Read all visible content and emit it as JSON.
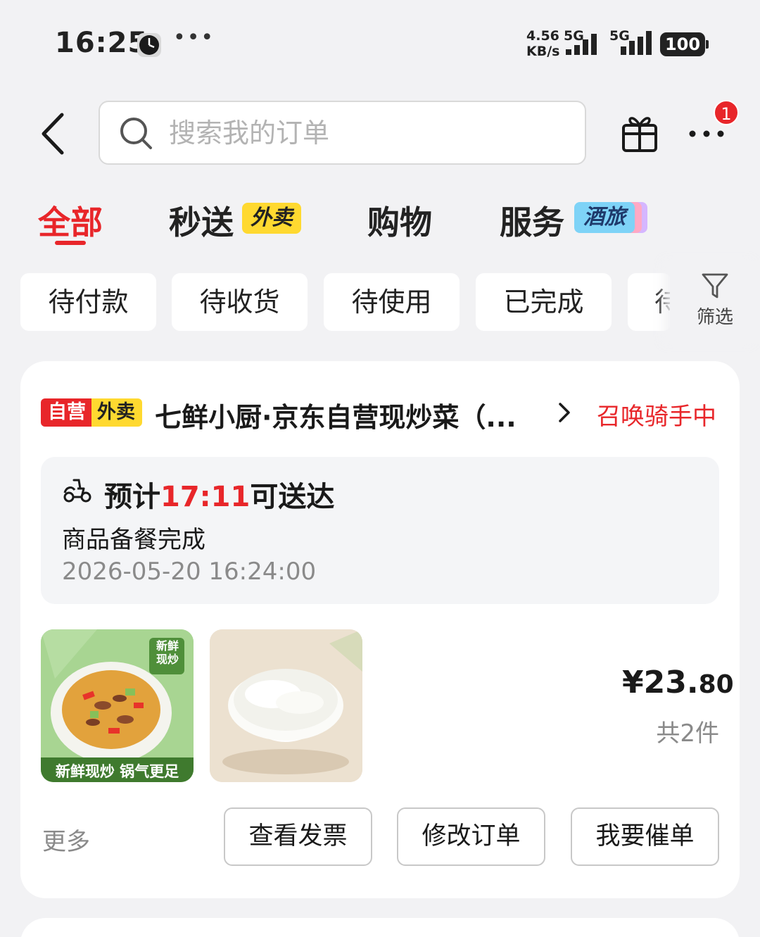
{
  "status_bar": {
    "time": "16:25",
    "net_speed_value": "4.56",
    "net_speed_unit": "KB/s",
    "network_1": "5G",
    "network_2": "5G",
    "battery": "100"
  },
  "header": {
    "search_placeholder": "搜索我的订单",
    "notification_count": "1"
  },
  "tabs": [
    {
      "label": "全部",
      "active": true
    },
    {
      "label": "秒送",
      "tag": "外卖"
    },
    {
      "label": "购物"
    },
    {
      "label": "服务",
      "tag": "酒旅"
    }
  ],
  "filter_chips": [
    "待付款",
    "待收货",
    "待使用",
    "已完成",
    "待"
  ],
  "filter_label": "筛选",
  "order": {
    "tag_self": "自营",
    "tag_type": "外卖",
    "store_name": "七鲜小厨·京东自营现炒菜（...",
    "status": "召唤骑手中",
    "eta_prefix": "预计",
    "eta_time": "17:11",
    "eta_suffix": "可送达",
    "progress_text": "商品备餐完成",
    "progress_time": "2026-05-20 16:24:00",
    "product_1_badge_top": "新鲜现炒",
    "product_1_badge_bottom": "新鲜现炒 锅气更足",
    "price_main": "¥23.",
    "price_decimal": "80",
    "item_count": "共2件",
    "more": "更多",
    "buttons": [
      "查看发票",
      "修改订单",
      "我要催单"
    ]
  },
  "colors": {
    "accent": "#e8262a",
    "background": "#f2f2f4",
    "tag_yellow": "#ffd930",
    "tag_blue": "#7ed3f7"
  }
}
